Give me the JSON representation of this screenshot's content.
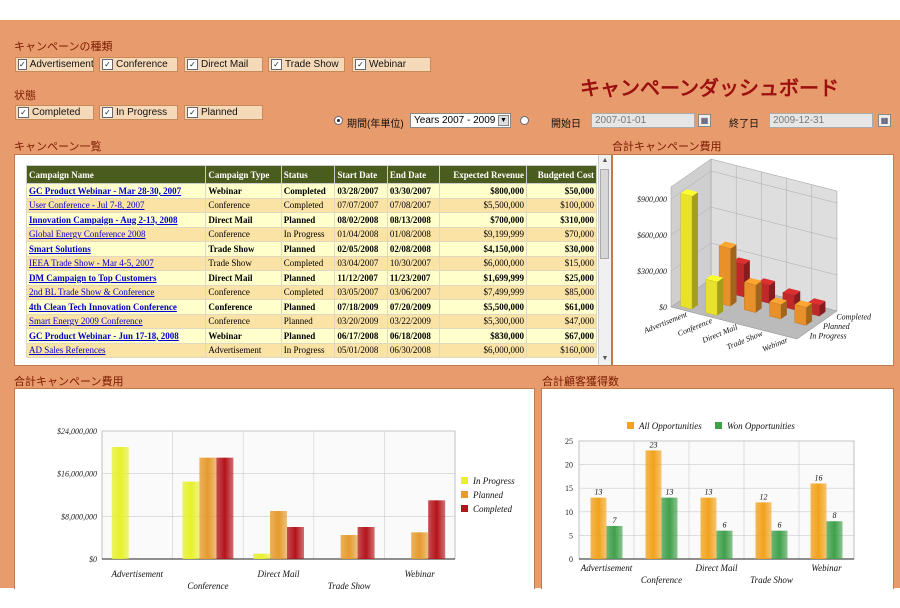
{
  "header": {
    "campaign_type_label": "キャンペーンの種類",
    "title": "キャンペーンダッシュボード",
    "campaign_types": [
      "Advertisement",
      "Conference",
      "Direct Mail",
      "Trade Show",
      "Webinar"
    ],
    "status_label": "状態",
    "statuses": [
      "Completed",
      "In Progress",
      "Planned"
    ],
    "period_label": "期間(年単位)",
    "period_value": "Years 2007 - 2009",
    "start_label": "開始日",
    "start_value": "2007-01-01",
    "end_label": "終了日",
    "end_value": "2009-12-31"
  },
  "campaign_list": {
    "title": "キャンペーン一覧",
    "columns": [
      "Campaign Name",
      "Campaign Type",
      "Status",
      "Start Date",
      "End Date",
      "Expected Revenue",
      "Budgeted Cost"
    ],
    "rows": [
      [
        "GC Product Webinar - Mar 28-30, 2007",
        "Webinar",
        "Completed",
        "03/28/2007",
        "03/30/2007",
        "$800,000",
        "$50,000"
      ],
      [
        "User Conference - Jul 7-8, 2007",
        "Conference",
        "Completed",
        "07/07/2007",
        "07/08/2007",
        "$5,500,000",
        "$100,000"
      ],
      [
        "Innovation Campaign - Aug 2-13, 2008",
        "Direct Mail",
        "Planned",
        "08/02/2008",
        "08/13/2008",
        "$700,000",
        "$310,000"
      ],
      [
        "Global Energy Conference 2008",
        "Conference",
        "In Progress",
        "01/04/2008",
        "01/08/2008",
        "$9,199,999",
        "$70,000"
      ],
      [
        "Smart Solutions",
        "Trade Show",
        "Planned",
        "02/05/2008",
        "02/08/2008",
        "$4,150,000",
        "$30,000"
      ],
      [
        "IEEA Trade Show - Mar 4-5, 2007",
        "Trade Show",
        "Completed",
        "03/04/2007",
        "10/30/2007",
        "$6,000,000",
        "$15,000"
      ],
      [
        "DM Campaign to Top Customers",
        "Direct Mail",
        "Planned",
        "11/12/2007",
        "11/23/2007",
        "$1,699,999",
        "$25,000"
      ],
      [
        "2nd BL Trade Show & Conference",
        "Conference",
        "Completed",
        "03/05/2007",
        "03/06/2007",
        "$7,499,999",
        "$85,000"
      ],
      [
        "4th Clean Tech Innovation Conference",
        "Conference",
        "Planned",
        "07/18/2009",
        "07/20/2009",
        "$5,500,000",
        "$61,000"
      ],
      [
        "Smart Energy 2009 Conference",
        "Conference",
        "Planned",
        "03/20/2009",
        "03/22/2009",
        "$5,300,000",
        "$47,000"
      ],
      [
        "GC Product Webinar - Jun 17-18, 2008",
        "Webinar",
        "Planned",
        "06/17/2008",
        "06/18/2008",
        "$830,000",
        "$67,000"
      ],
      [
        "AD Sales References",
        "Advertisement",
        "In Progress",
        "05/01/2008",
        "06/30/2008",
        "$6,000,000",
        "$160,000"
      ]
    ]
  },
  "chart_3d": {
    "title": "合計キャンペーン費用"
  },
  "chart_bar": {
    "title": "合計キャンペーン費用"
  },
  "chart_customers": {
    "title": "合計顧客獲得数"
  },
  "chart_data": [
    {
      "type": "bar",
      "subtype": "3d",
      "categories": [
        "Advertisement",
        "Conference",
        "Direct Mail",
        "Trade Show",
        "Webinar"
      ],
      "series": [
        {
          "name": "In Progress",
          "values": [
            940000,
            280000,
            0,
            0,
            0
          ]
        },
        {
          "name": "Planned",
          "values": [
            0,
            480000,
            230000,
            120000,
            150000
          ]
        },
        {
          "name": "Completed",
          "values": [
            0,
            270000,
            150000,
            120000,
            90000
          ]
        }
      ],
      "yticks": [
        "$0",
        "$300,000",
        "$600,000",
        "$900,000"
      ],
      "ylim": [
        0,
        1000000
      ],
      "colors": [
        "#e9e22a",
        "#e8902a",
        "#c0282a"
      ]
    },
    {
      "type": "bar",
      "categories": [
        "Advertisement",
        "Conference",
        "Direct Mail",
        "Trade Show",
        "Webinar"
      ],
      "series": [
        {
          "name": "In Progress",
          "values": [
            21000000,
            14500000,
            1000000,
            0,
            0
          ]
        },
        {
          "name": "Planned",
          "values": [
            0,
            19000000,
            9000000,
            4500000,
            5000000
          ]
        },
        {
          "name": "Completed",
          "values": [
            0,
            19000000,
            6000000,
            6000000,
            11000000
          ]
        }
      ],
      "yticks": [
        "$0",
        "$8,000,000",
        "$16,000,000",
        "$24,000,000"
      ],
      "ylim": [
        0,
        24000000
      ],
      "legend": "right",
      "colors": [
        "#e7f12a",
        "#e59a2c",
        "#b4141a"
      ]
    },
    {
      "type": "bar",
      "categories": [
        "Advertisement",
        "Conference",
        "Direct Mail",
        "Trade Show",
        "Webinar"
      ],
      "series": [
        {
          "name": "All Opportunities",
          "values": [
            13,
            23,
            13,
            12,
            16
          ]
        },
        {
          "name": "Won Opportunities",
          "values": [
            7,
            13,
            6,
            6,
            8
          ]
        }
      ],
      "yticks": [
        "0",
        "5",
        "10",
        "15",
        "20",
        "25"
      ],
      "ylim": [
        0,
        25
      ],
      "legend": "top",
      "colors": [
        "#f2a21c",
        "#3fa04a"
      ]
    }
  ]
}
